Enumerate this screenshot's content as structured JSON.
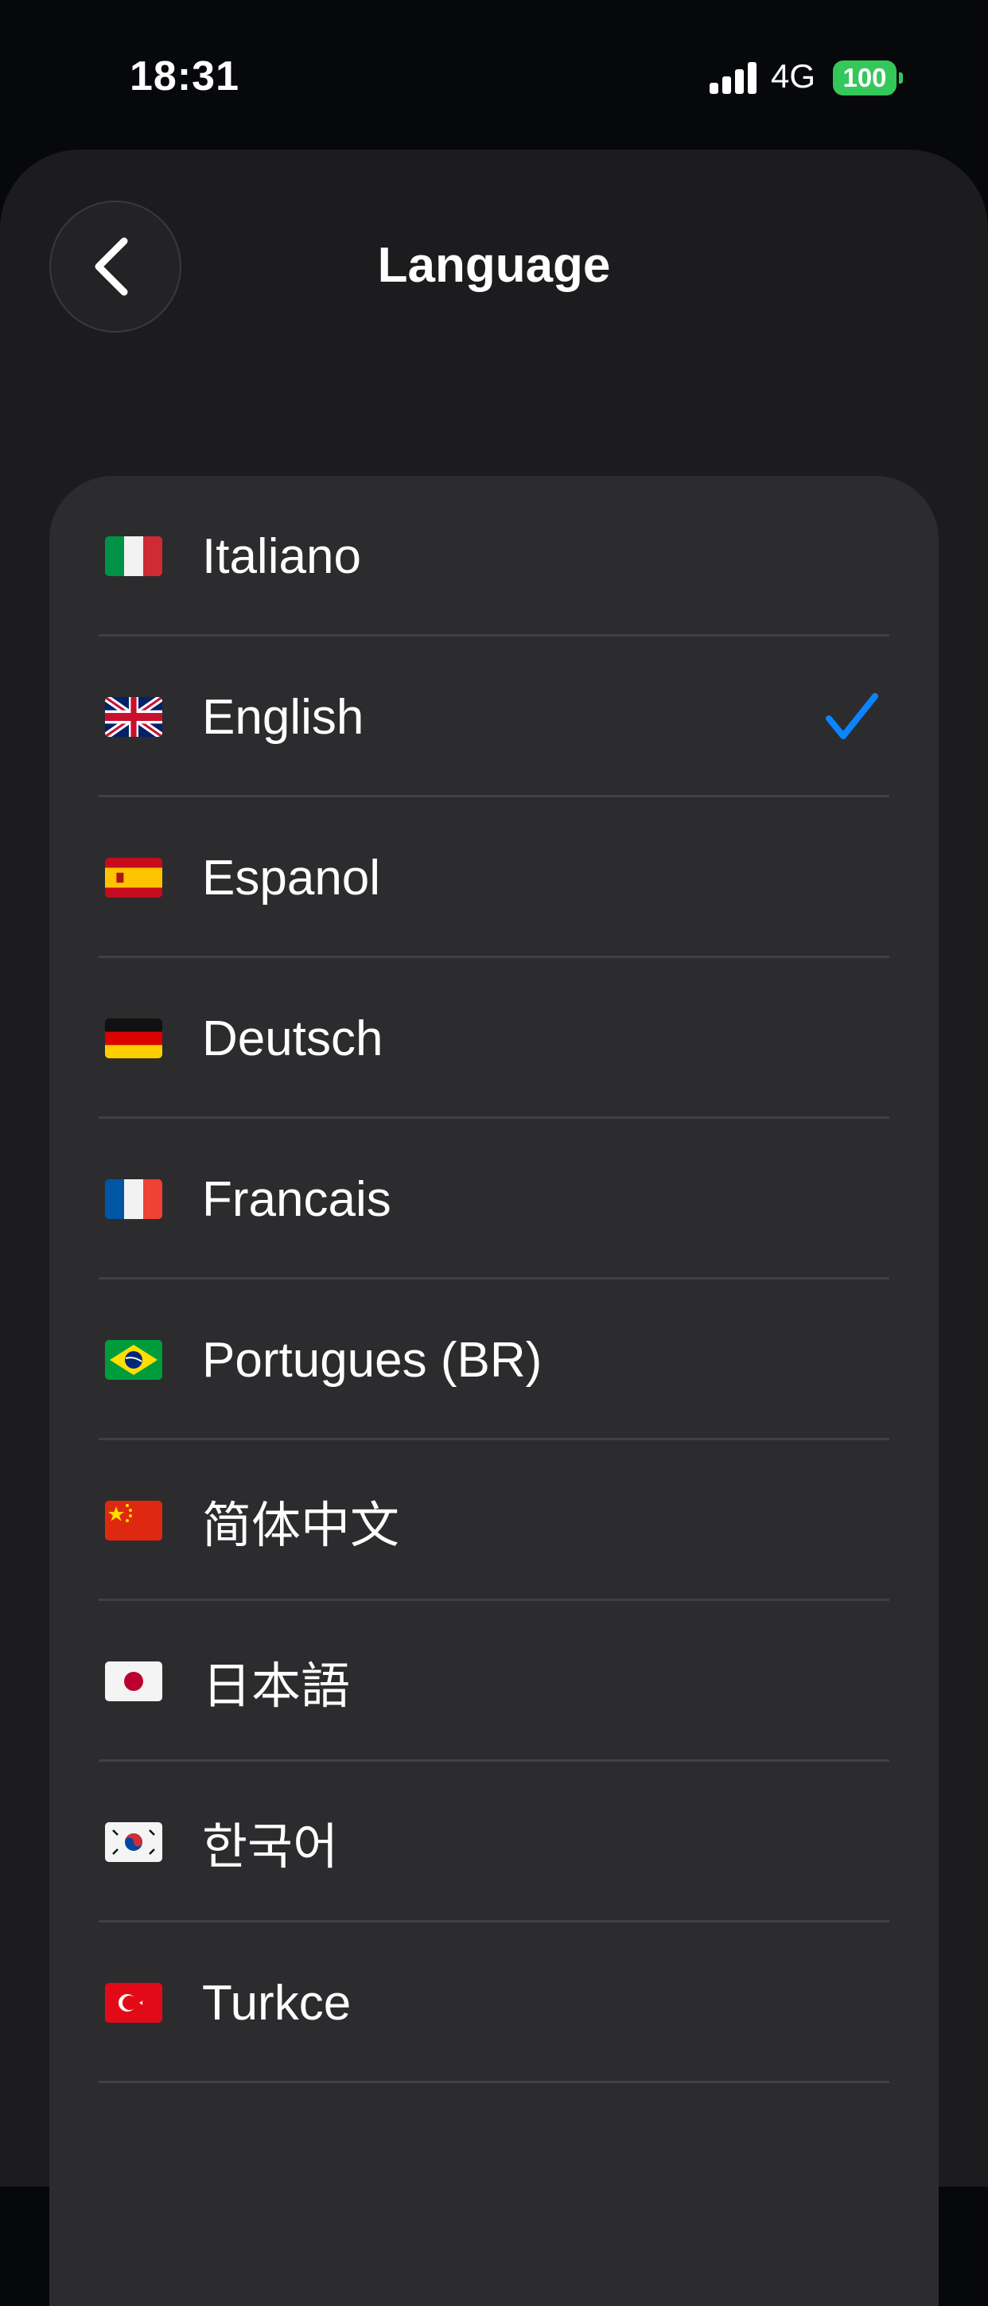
{
  "status_bar": {
    "time": "18:31",
    "network": "4G",
    "battery": "100"
  },
  "header": {
    "title": "Language",
    "back_icon": "chevron-left-icon"
  },
  "languages": [
    {
      "label": "Italiano",
      "flag": "it",
      "selected": false
    },
    {
      "label": "English",
      "flag": "gb",
      "selected": true
    },
    {
      "label": "Espanol",
      "flag": "es",
      "selected": false
    },
    {
      "label": "Deutsch",
      "flag": "de",
      "selected": false
    },
    {
      "label": "Francais",
      "flag": "fr",
      "selected": false
    },
    {
      "label": "Portugues (BR)",
      "flag": "br",
      "selected": false
    },
    {
      "label": "简体中文",
      "flag": "cn",
      "selected": false
    },
    {
      "label": "日本語",
      "flag": "jp",
      "selected": false
    },
    {
      "label": "한국어",
      "flag": "kr",
      "selected": false
    },
    {
      "label": "Turkce",
      "flag": "tr",
      "selected": false
    }
  ],
  "colors": {
    "background": "#07080b",
    "sheet": "#1c1c1e",
    "card": "#2c2c2e",
    "separator": "#414144",
    "accent_check": "#0a84ff",
    "battery": "#34c759"
  }
}
